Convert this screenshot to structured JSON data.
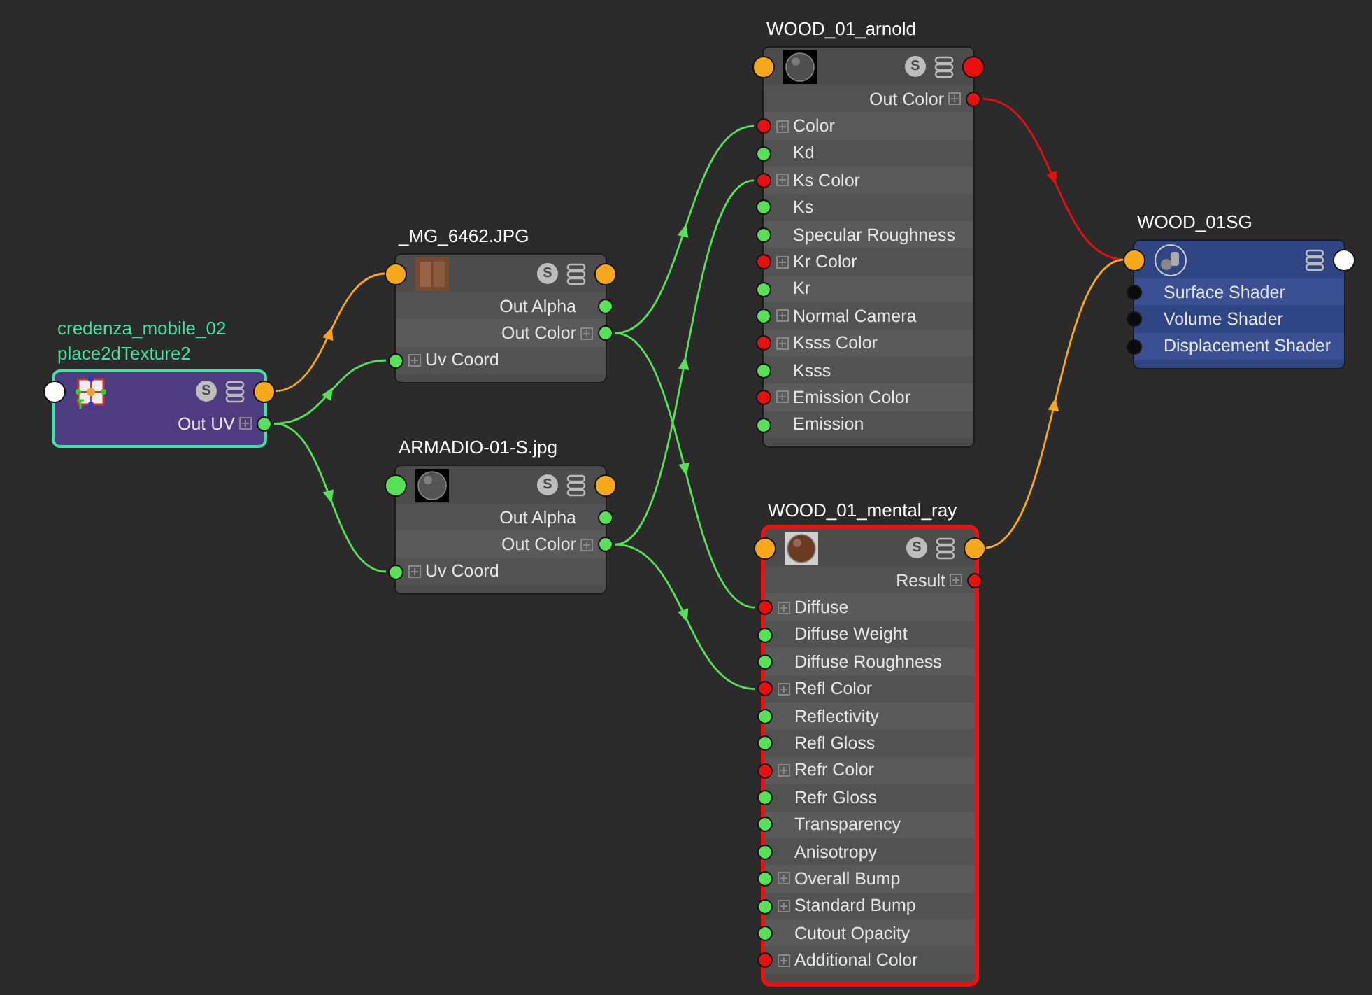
{
  "nodes": [
    {
      "title": [
        "credenza_mobile_02",
        "place2dTexture2"
      ],
      "kind": "utility",
      "selected": true,
      "highlighted": false,
      "badge": "S",
      "in_port": {
        "color": "#ffffff"
      },
      "out_port": {
        "color": "#f7a81b"
      },
      "rows": [
        {
          "label": "Out UV",
          "kind": "output",
          "color": "#57e157",
          "expandable": true
        }
      ]
    },
    {
      "title": [
        "_MG_6462.JPG"
      ],
      "kind": "texture",
      "selected": false,
      "highlighted": false,
      "badge": "S",
      "in_port": {
        "color": "#f7a81b"
      },
      "out_port": {
        "color": "#f7a81b"
      },
      "rows": [
        {
          "label": "Out Alpha",
          "kind": "output",
          "color": "#57e157",
          "expandable": false
        },
        {
          "label": "Out Color",
          "kind": "output",
          "color": "#57e157",
          "expandable": true
        },
        {
          "label": "Uv Coord",
          "kind": "input",
          "color": "#57e157",
          "expandable": true
        }
      ]
    },
    {
      "title": [
        "ARMADIO-01-S.jpg"
      ],
      "kind": "texture",
      "selected": false,
      "highlighted": false,
      "badge": "S",
      "in_port": {
        "color": "#57e157"
      },
      "out_port": {
        "color": "#f7a81b"
      },
      "rows": [
        {
          "label": "Out Alpha",
          "kind": "output",
          "color": "#57e157",
          "expandable": false
        },
        {
          "label": "Out Color",
          "kind": "output",
          "color": "#57e157",
          "expandable": true
        },
        {
          "label": "Uv Coord",
          "kind": "input",
          "color": "#57e157",
          "expandable": true
        }
      ]
    },
    {
      "title": [
        "WOOD_01_arnold"
      ],
      "kind": "shader",
      "selected": false,
      "highlighted": false,
      "badge": "S",
      "in_port": {
        "color": "#f7a81b"
      },
      "out_port": {
        "color": "#e80f0f"
      },
      "rows": [
        {
          "label": "Out Color",
          "kind": "output",
          "color": "#e80f0f",
          "expandable": true
        },
        {
          "label": "Color",
          "kind": "input",
          "color": "#e80f0f",
          "expandable": true
        },
        {
          "label": "Kd",
          "kind": "input",
          "color": "#57e157",
          "expandable": false
        },
        {
          "label": "Ks Color",
          "kind": "input",
          "color": "#e80f0f",
          "expandable": true
        },
        {
          "label": "Ks",
          "kind": "input",
          "color": "#57e157",
          "expandable": false
        },
        {
          "label": "Specular Roughness",
          "kind": "input",
          "color": "#57e157",
          "expandable": false
        },
        {
          "label": "Kr Color",
          "kind": "input",
          "color": "#e80f0f",
          "expandable": true
        },
        {
          "label": "Kr",
          "kind": "input",
          "color": "#57e157",
          "expandable": false
        },
        {
          "label": "Normal Camera",
          "kind": "input",
          "color": "#57e157",
          "expandable": true
        },
        {
          "label": "Ksss Color",
          "kind": "input",
          "color": "#e80f0f",
          "expandable": true
        },
        {
          "label": "Ksss",
          "kind": "input",
          "color": "#57e157",
          "expandable": false
        },
        {
          "label": "Emission Color",
          "kind": "input",
          "color": "#e80f0f",
          "expandable": true
        },
        {
          "label": "Emission",
          "kind": "input",
          "color": "#57e157",
          "expandable": false
        }
      ]
    },
    {
      "title": [
        "WOOD_01_mental_ray"
      ],
      "kind": "shader",
      "selected": false,
      "highlighted": true,
      "badge": "S",
      "in_port": {
        "color": "#f7a81b"
      },
      "out_port": {
        "color": "#f7a81b"
      },
      "rows": [
        {
          "label": "Result",
          "kind": "output",
          "color": "#e80f0f",
          "expandable": true
        },
        {
          "label": "Diffuse",
          "kind": "input",
          "color": "#e80f0f",
          "expandable": true
        },
        {
          "label": "Diffuse Weight",
          "kind": "input",
          "color": "#57e157",
          "expandable": false
        },
        {
          "label": "Diffuse Roughness",
          "kind": "input",
          "color": "#57e157",
          "expandable": false
        },
        {
          "label": "Refl Color",
          "kind": "input",
          "color": "#e80f0f",
          "expandable": true
        },
        {
          "label": "Reflectivity",
          "kind": "input",
          "color": "#57e157",
          "expandable": false
        },
        {
          "label": "Refl Gloss",
          "kind": "input",
          "color": "#57e157",
          "expandable": false
        },
        {
          "label": "Refr Color",
          "kind": "input",
          "color": "#e80f0f",
          "expandable": true
        },
        {
          "label": "Refr Gloss",
          "kind": "input",
          "color": "#57e157",
          "expandable": false
        },
        {
          "label": "Transparency",
          "kind": "input",
          "color": "#57e157",
          "expandable": false
        },
        {
          "label": "Anisotropy",
          "kind": "input",
          "color": "#57e157",
          "expandable": false
        },
        {
          "label": "Overall Bump",
          "kind": "input",
          "color": "#57e157",
          "expandable": true
        },
        {
          "label": "Standard Bump",
          "kind": "input",
          "color": "#57e157",
          "expandable": true
        },
        {
          "label": "Cutout Opacity",
          "kind": "input",
          "color": "#57e157",
          "expandable": false
        },
        {
          "label": "Additional Color",
          "kind": "input",
          "color": "#e80f0f",
          "expandable": true
        }
      ]
    },
    {
      "title": [
        "WOOD_01SG"
      ],
      "kind": "shading-group",
      "selected": false,
      "highlighted": false,
      "in_port": {
        "color": "#f7a81b"
      },
      "out_port": {
        "color": "#ffffff"
      },
      "rows": [
        {
          "label": "Surface Shader",
          "kind": "input",
          "color": "#0b0b0b",
          "expandable": false
        },
        {
          "label": "Volume Shader",
          "kind": "input",
          "color": "#0b0b0b",
          "expandable": false
        },
        {
          "label": "Displacement Shader",
          "kind": "input",
          "color": "#0b0b0b",
          "expandable": false
        }
      ]
    }
  ]
}
